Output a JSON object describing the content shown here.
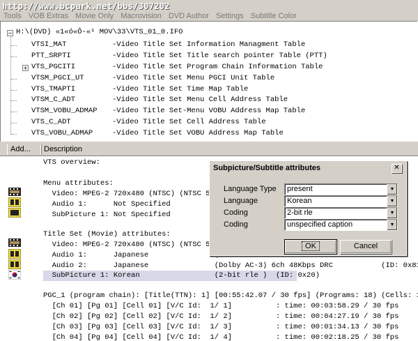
{
  "watermark_url": "http://www.bcpark.net/bbs/307202",
  "menu": [
    "Tools",
    "VOB Extras",
    "Movie Only",
    "Macrovision",
    "DVD Author",
    "Settings",
    "Subtitle Color"
  ],
  "tree": {
    "root": "H:\\(DVD) «1«ó«Ô-«¹ MOV\\33\\VTS_01_0.IFO",
    "items": [
      {
        "name": "VTSI_MAT",
        "desc": "-Video Title Set Information Managment Table"
      },
      {
        "name": "PTT_SRPTI",
        "desc": "-Video Title Set Title search pointer Table (PTT)"
      },
      {
        "name": "VTS_PGCITI",
        "desc": "-Video Title Set Program Chain Information Table"
      },
      {
        "name": "VTSM_PGCI_UT",
        "desc": "-Video Title Set Menu PGCI Unit Table"
      },
      {
        "name": "VTS_TMAPTI",
        "desc": "-Video Title Set Time Map Table"
      },
      {
        "name": "VTSM_C_ADT",
        "desc": "-Video Title Set Menu Cell Address Table"
      },
      {
        "name": "VTSM_VOBU_ADMAP",
        "desc": "-Video Title Set-Menu VOBU Address Map Table"
      },
      {
        "name": "VTS_C_ADT",
        "desc": "-Video Title Set Cell Address Table"
      },
      {
        "name": "VTS_VOBU_ADMAP",
        "desc": "-Video Title Set VOBU Address Map Table"
      }
    ]
  },
  "columns": {
    "addr": "Add...",
    "desc": "Description"
  },
  "details": [
    "VTS overview:",
    "",
    "Menu attributes:",
    "  Video: MPEG-2 720x480 (NTSC) (NTSC 52",
    "  Audio 1:      Not Specified          (D",
    "  SubPicture 1: Not Specified          (2",
    "",
    "Title Set (Movie) attributes:",
    "  Video: MPEG-2 720x480 (NTSC) (NTSC 52",
    "  Audio 1:      Japanese               (D",
    "  Audio 2:      Japanese               (Dolby AC-3) 6ch 48Kbps DRC           (ID: 0x81)",
    "  SubPicture 1: Korean                 (2-bit rle )  (ID: 0x20)",
    "",
    "PGC_1 (program chain): [Title(TTN): 1] [00:55:42.07 / 30 fps] (Programs: 18) (Cells: 18)",
    "  [Ch 01] [Pg 01] [Cell 01] [V/C Id:  1/ 1]          : time: 00:03:58.29 / 30 fps     [Po",
    "  [Ch 02] [Pg 02] [Cell 02] [V/C Id:  1/ 2]          : time: 00:04:27.19 / 30 fps     [Po",
    "  [Ch 03] [Pg 03] [Cell 03] [V/C Id:  1/ 3]          : time: 00:01:34.13 / 30 fps     [Po",
    "  [Ch 04] [Pg 04] [Cell 04] [V/C Id:  1/ 4]          : time: 00:02:18.25 / 30 fps     [Po"
  ],
  "dialog": {
    "title": "Subpicture/Subtitle attributes",
    "fields": [
      {
        "label": "Language Type",
        "value": "present"
      },
      {
        "label": "Language",
        "value": "Korean"
      },
      {
        "label": "Coding",
        "value": "2-bit rle"
      },
      {
        "label": "Coding",
        "value": "unspecified caption"
      }
    ],
    "ok": "OK",
    "cancel": "Cancel"
  }
}
